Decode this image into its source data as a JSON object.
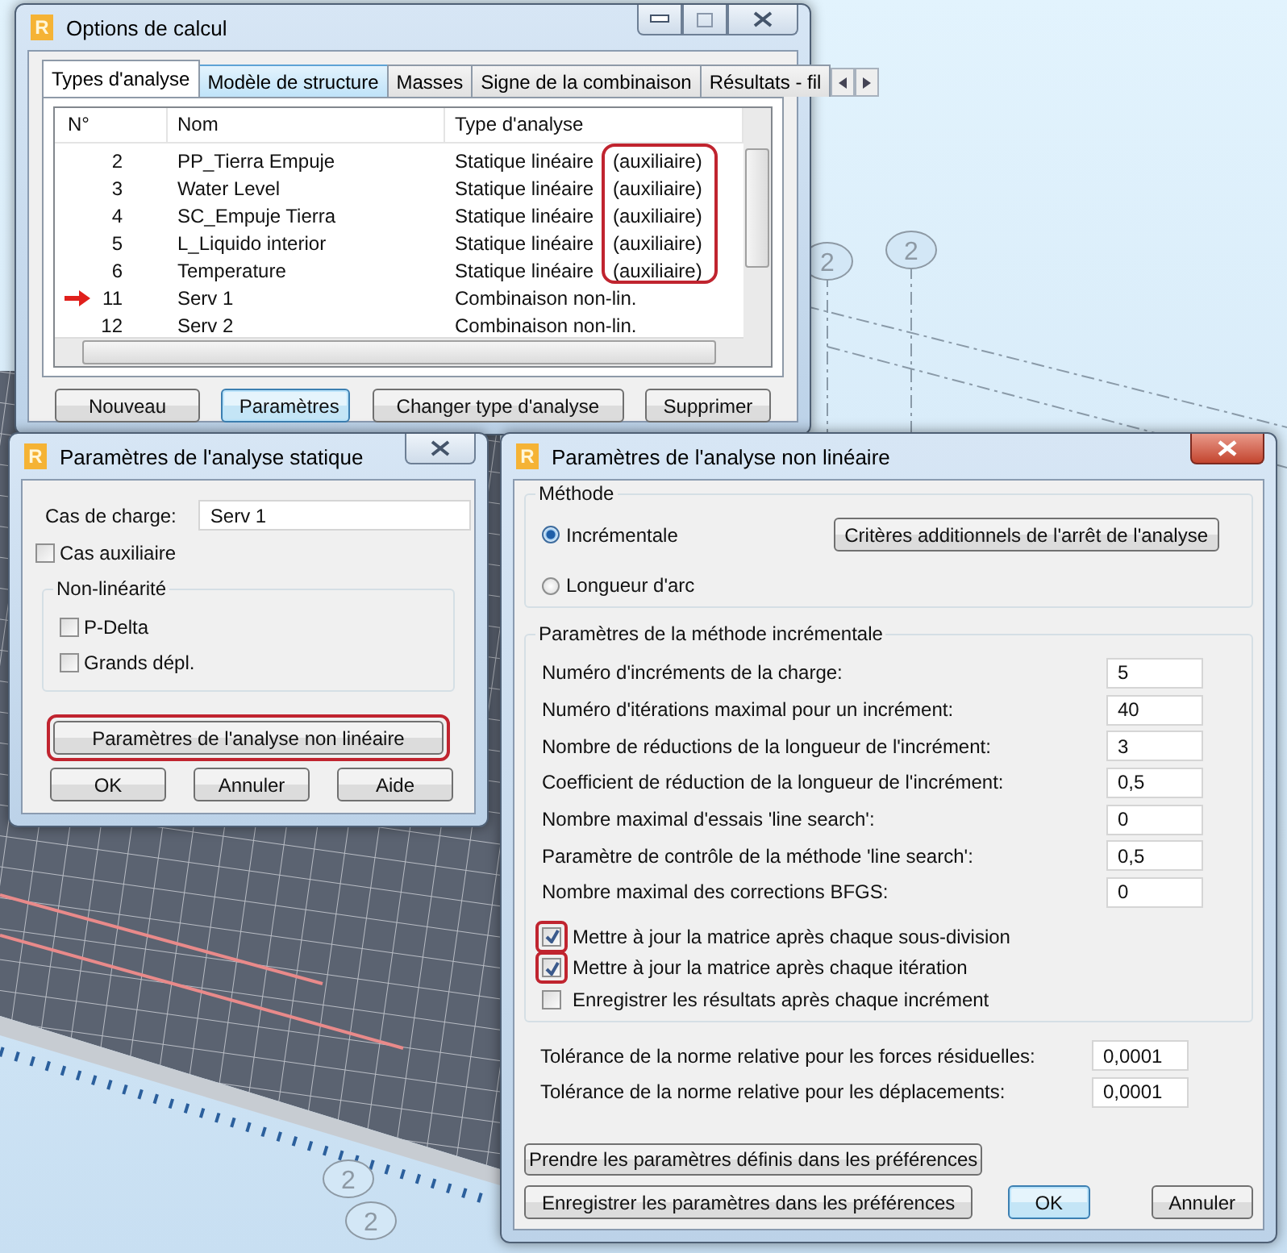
{
  "background": {
    "axis_labels": [
      "2",
      "2",
      "2",
      "2"
    ]
  },
  "options_window": {
    "logo": "R",
    "title": "Options de calcul",
    "tabs": [
      {
        "label": "Types d'analyse",
        "selected": true,
        "hovered": false
      },
      {
        "label": "Modèle de structure",
        "selected": false,
        "hovered": true
      },
      {
        "label": "Masses",
        "selected": false,
        "hovered": false
      },
      {
        "label": "Signe de la combinaison",
        "selected": false,
        "hovered": false
      },
      {
        "label": "Résultats - fil",
        "selected": false,
        "hovered": false
      }
    ],
    "table": {
      "columns": [
        "N°",
        "Nom",
        "Type d'analyse"
      ],
      "note_highlight": true,
      "rows": [
        {
          "number": "2",
          "name": "PP_Tierra Empuje",
          "type": "Statique linéaire",
          "note": "(auxiliaire)",
          "current": false
        },
        {
          "number": "3",
          "name": "Water Level",
          "type": "Statique linéaire",
          "note": "(auxiliaire)",
          "current": false
        },
        {
          "number": "4",
          "name": "SC_Empuje Tierra",
          "type": "Statique linéaire",
          "note": "(auxiliaire)",
          "current": false
        },
        {
          "number": "5",
          "name": "L_Liquido interior",
          "type": "Statique linéaire",
          "note": "(auxiliaire)",
          "current": false
        },
        {
          "number": "6",
          "name": "Temperature",
          "type": "Statique linéaire",
          "note": "(auxiliaire)",
          "current": false
        },
        {
          "number": "11",
          "name": "Serv 1",
          "type": "Combinaison non-lin.",
          "current": true
        },
        {
          "number": "12",
          "name": "Serv 2",
          "type": "Combinaison non-lin.",
          "current": false
        }
      ]
    },
    "buttons": [
      {
        "label": "Nouveau",
        "default": false
      },
      {
        "label": "Paramètres",
        "default": true
      },
      {
        "label": "Changer type d'analyse",
        "default": false
      },
      {
        "label": "Supprimer",
        "default": false
      }
    ]
  },
  "static_window": {
    "logo": "R",
    "title": "Paramètres de l'analyse statique",
    "load_case": {
      "label": "Cas de charge:",
      "value": "Serv 1"
    },
    "auxiliary": {
      "label": "Cas auxiliaire",
      "checked": false
    },
    "nonlinearity": {
      "title": "Non-linéarité",
      "options": [
        {
          "label": "P-Delta",
          "checked": false
        },
        {
          "label": "Grands dépl.",
          "checked": false
        }
      ]
    },
    "nonlinear_button": {
      "label": "Paramètres de l'analyse non linéaire",
      "highlighted": true
    },
    "buttons": [
      "OK",
      "Annuler",
      "Aide"
    ]
  },
  "nonlinear_window": {
    "logo": "R",
    "title": "Paramètres de l'analyse non linéaire",
    "method": {
      "title": "Méthode",
      "options": [
        {
          "label": "Incrémentale",
          "selected": true
        },
        {
          "label": "Longueur d'arc",
          "selected": false
        }
      ],
      "criteria_button": "Critères additionnels de l'arrêt de l'analyse"
    },
    "incremental": {
      "title": "Paramètres de la méthode incrémentale",
      "fields": [
        {
          "label": "Numéro d'incréments de la charge:",
          "value": "5"
        },
        {
          "label": "Numéro d'itérations maximal pour un incrément:",
          "value": "40"
        },
        {
          "label": "Nombre de réductions de la longueur de l'incrément:",
          "value": "3"
        },
        {
          "label": "Coefficient de réduction de la longueur de l'incrément:",
          "value": "0,5"
        },
        {
          "label": "Nombre maximal d'essais 'line search':",
          "value": "0"
        },
        {
          "label": "Paramètre de contrôle de la méthode 'line search':",
          "value": "0,5"
        },
        {
          "label": "Nombre maximal des corrections BFGS:",
          "value": "0"
        }
      ],
      "checks": [
        {
          "label": "Mettre à jour la matrice après chaque sous-division",
          "checked": true,
          "highlighted": true
        },
        {
          "label": "Mettre à jour la matrice après chaque itération",
          "checked": true,
          "highlighted": true
        },
        {
          "label": "Enregistrer les résultats après chaque incrément",
          "checked": false,
          "highlighted": false
        }
      ]
    },
    "tolerances": [
      {
        "label": "Tolérance de la norme relative pour les forces résiduelles:",
        "value": "0,0001"
      },
      {
        "label": "Tolérance de la norme relative pour les déplacements:",
        "value": "0,0001"
      }
    ],
    "preference_buttons": [
      "Prendre les paramètres définis dans les préférences",
      "Enregistrer les paramètres dans les préférences"
    ],
    "ok_button": {
      "label": "OK",
      "default": true
    },
    "cancel_button": "Annuler"
  }
}
